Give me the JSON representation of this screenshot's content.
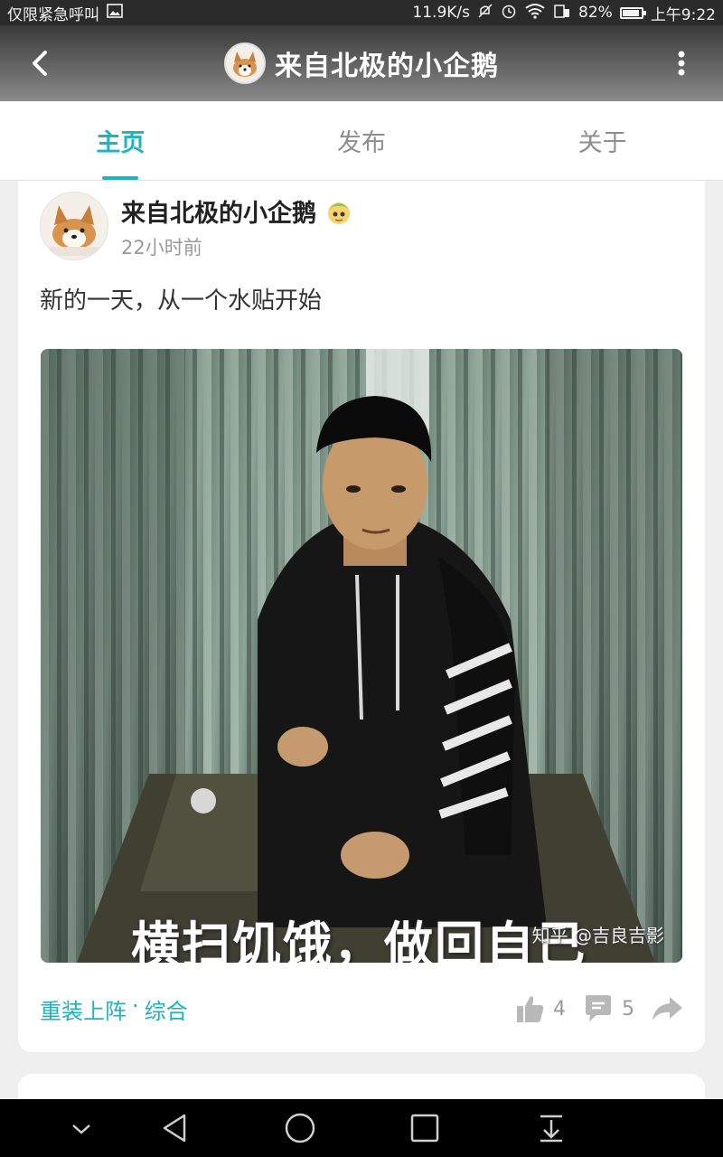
{
  "status_bar": {
    "left_text": "仅限紧急呼叫",
    "net_speed": "11.9K/s",
    "battery_percent": "82%",
    "battery_level": 0.82,
    "time": "上午9:22"
  },
  "header": {
    "title": "来自北极的小企鹅"
  },
  "tabs": [
    {
      "label": "主页",
      "active": true
    },
    {
      "label": "发布",
      "active": false
    },
    {
      "label": "关于",
      "active": false
    }
  ],
  "post": {
    "author": "来自北极的小企鹅",
    "time": "22小时前",
    "text": "新的一天，从一个水贴开始",
    "image_caption": "横扫饥饿，做回自己",
    "image_watermark": "知乎 @吉良吉影",
    "category_section": "重装上阵",
    "category_dot": "·",
    "category_sub": "综合",
    "like_count": "4",
    "comment_count": "5"
  },
  "colors": {
    "accent": "#1fb3bd",
    "header_dark": "#3a3a3a"
  },
  "icons": [
    "back-arrow-icon",
    "more-vertical-icon",
    "thumbs-up-icon",
    "comment-icon",
    "share-icon",
    "chevron-down-icon",
    "nav-back-icon",
    "nav-home-icon",
    "nav-recents-icon",
    "nav-notification-icon"
  ]
}
